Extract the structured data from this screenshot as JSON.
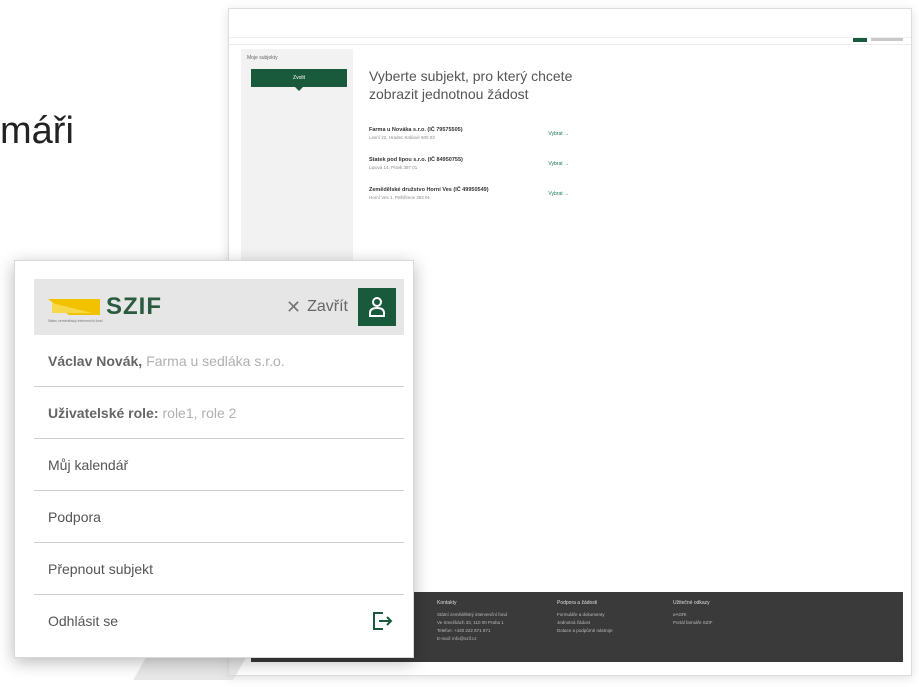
{
  "background": {
    "heading_fragment": "máři"
  },
  "desktop": {
    "sidebar_label": "Moje subjekty",
    "sidebar_button": "Zvolit",
    "title": "Vyberte subjekt, pro který chcete zobrazit jednotnou žádost",
    "subjects": [
      {
        "name": "Farma u Nováka s.r.o. (IČ 79575505)",
        "address": "Lesní 22, Hradec Králové 500 03",
        "action": "Vybrat →"
      },
      {
        "name": "Statek pod lipou s.r.o. (IČ 84950755)",
        "address": "Lipová 14, Písek 397 01",
        "action": "Vybrat →"
      },
      {
        "name": "Zemědělské družstvo Horní Ves (IČ 49950549)",
        "address": "Horní Ves 1, Pelhřimov 393 01",
        "action": "Vybrat →"
      }
    ],
    "footer": {
      "col1": {
        "heading": "Kontakty",
        "lines": [
          "Státní zemědělský intervenční fond",
          "Ve Smečkách 33, 110 00 Praha 1",
          "Telefon: +420 222 871 871",
          "E-mail: info@szif.cz"
        ]
      },
      "col2": {
        "heading": "Podpora a žádosti",
        "lines": [
          "Formuláře a dokumenty",
          "Jednotná žádost",
          "Dotace a podpůrné nástroje"
        ]
      },
      "col3": {
        "heading": "Užitečné odkazy",
        "lines": [
          "eAGRI",
          "Portál farmáře SZIF"
        ]
      }
    }
  },
  "mobile": {
    "logo_text": "SZIF",
    "logo_subtitle": "Státní zemědělský intervenční fond",
    "close_label": "Zavřít",
    "user_name": "Václav Novák,",
    "user_company": "Farma u sedláka s.r.o.",
    "roles_label": "Uživatelské role:",
    "roles_value": "role1, role 2",
    "menu": {
      "calendar": "Můj kalendář",
      "support": "Podpora",
      "switch_subject": "Přepnout subjekt",
      "logout": "Odhlásit se"
    }
  },
  "colors": {
    "brand_green": "#1a5a3c",
    "logo_yellow": "#f2c200",
    "footer_bg": "#3a3a3a"
  }
}
